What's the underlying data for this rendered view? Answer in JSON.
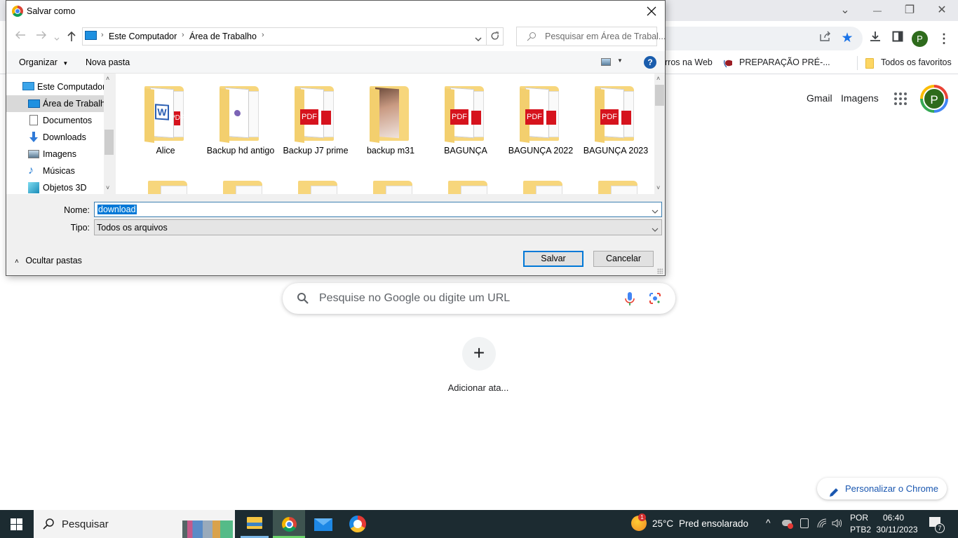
{
  "browser": {
    "window_controls": {
      "tabsearch": "⌄",
      "minimize": "—",
      "restore": "❐",
      "close": "✕"
    },
    "toolbar": {
      "share_icon": "share-icon",
      "bookmark_star": "★",
      "download_icon": "⤓",
      "sidepanel_icon": "◧",
      "profile_initial": "P",
      "menu": "⋮"
    },
    "bookmarks": [
      {
        "label": "rros na Web"
      },
      {
        "label": "PREPARAÇÃO PRÉ-..."
      }
    ],
    "all_bookmarks": "Todos os favoritos"
  },
  "ntp": {
    "links": {
      "gmail": "Gmail",
      "images": "Imagens"
    },
    "profile_initial": "P",
    "search_placeholder": "Pesquise no Google ou digite um URL",
    "add_shortcut_symbol": "+",
    "add_shortcut_label": "Adicionar ata...",
    "customize_label": "Personalizar o Chrome"
  },
  "dialog": {
    "title": "Salvar como",
    "breadcrumb": [
      "Este Computador",
      "Área de Trabalho"
    ],
    "search_placeholder": "Pesquisar em Área de Trabal...",
    "organize_label": "Organizar",
    "new_folder_label": "Nova pasta",
    "nav_items": [
      {
        "label": "Este Computador",
        "icon": "computer-icon",
        "selected": false
      },
      {
        "label": "Área de Trabalho",
        "icon": "desktop-icon",
        "selected": true
      },
      {
        "label": "Documentos",
        "icon": "documents-icon",
        "selected": false
      },
      {
        "label": "Downloads",
        "icon": "downloads-icon",
        "selected": false
      },
      {
        "label": "Imagens",
        "icon": "pictures-icon",
        "selected": false
      },
      {
        "label": "Músicas",
        "icon": "music-icon",
        "selected": false
      },
      {
        "label": "Objetos 3D",
        "icon": "3d-objects-icon",
        "selected": false
      }
    ],
    "files": [
      {
        "name": "Alice",
        "preview": "word-pdf"
      },
      {
        "name": "Backup hd antigo",
        "preview": "document"
      },
      {
        "name": "Backup J7 prime",
        "preview": "pdf"
      },
      {
        "name": "backup m31",
        "preview": "photo"
      },
      {
        "name": "BAGUNÇA",
        "preview": "pdf"
      },
      {
        "name": "BAGUNÇA 2022",
        "preview": "pdf"
      },
      {
        "name": "BAGUNÇA 2023",
        "preview": "pdf"
      }
    ],
    "pdf_text": "PDF",
    "name_label": "Nome:",
    "name_value": "download",
    "type_label": "Tipo:",
    "type_value": "Todos os arquivos",
    "hide_folders_label": "Ocultar pastas",
    "save_label": "Salvar",
    "cancel_label": "Cancelar",
    "help_symbol": "?"
  },
  "taskbar": {
    "search_placeholder": "Pesquisar",
    "weather_temp": "25°C",
    "weather_desc": "Pred ensolarado",
    "weather_badge": "1",
    "lang_line1": "POR",
    "lang_line2": "PTB2",
    "time": "06:40",
    "date": "30/11/2023",
    "notification_count": "7"
  }
}
